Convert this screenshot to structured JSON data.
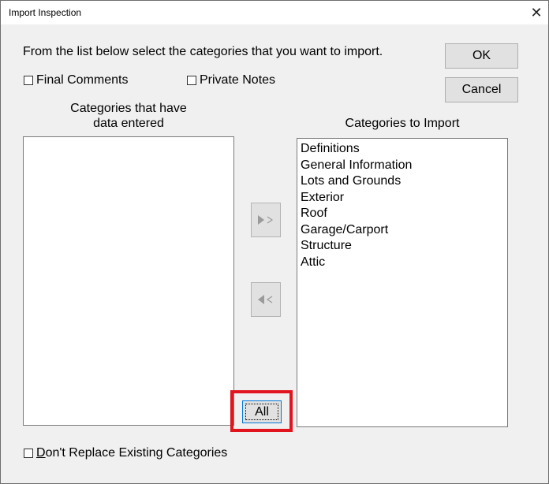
{
  "window": {
    "title": "Import Inspection",
    "close_glyph": "✕"
  },
  "instruction": "From the list below select the categories that you want to import.",
  "options": {
    "final_comments": {
      "label": "Final Comments",
      "checked": false
    },
    "private_notes": {
      "label": "Private Notes",
      "checked": false
    },
    "dont_replace": {
      "mnemonic": "D",
      "label_rest": "on't Replace Existing Categories",
      "checked": false
    }
  },
  "buttons": {
    "ok": "OK",
    "cancel": "Cancel",
    "all": "All",
    "add_icon": "arrow-right-icon",
    "remove_icon": "arrow-left-icon"
  },
  "left_list": {
    "header_line1": "Categories that have",
    "header_line2": "data entered",
    "items": []
  },
  "right_list": {
    "header": "Categories to Import",
    "items": [
      "Definitions",
      "General Information",
      "Lots and Grounds",
      "Exterior",
      "Roof",
      "Garage/Carport",
      "Structure",
      "Attic"
    ]
  },
  "colors": {
    "highlight": "#e0151d",
    "dialog_bg": "#f0f0f0",
    "focus_border": "#0078d7"
  }
}
